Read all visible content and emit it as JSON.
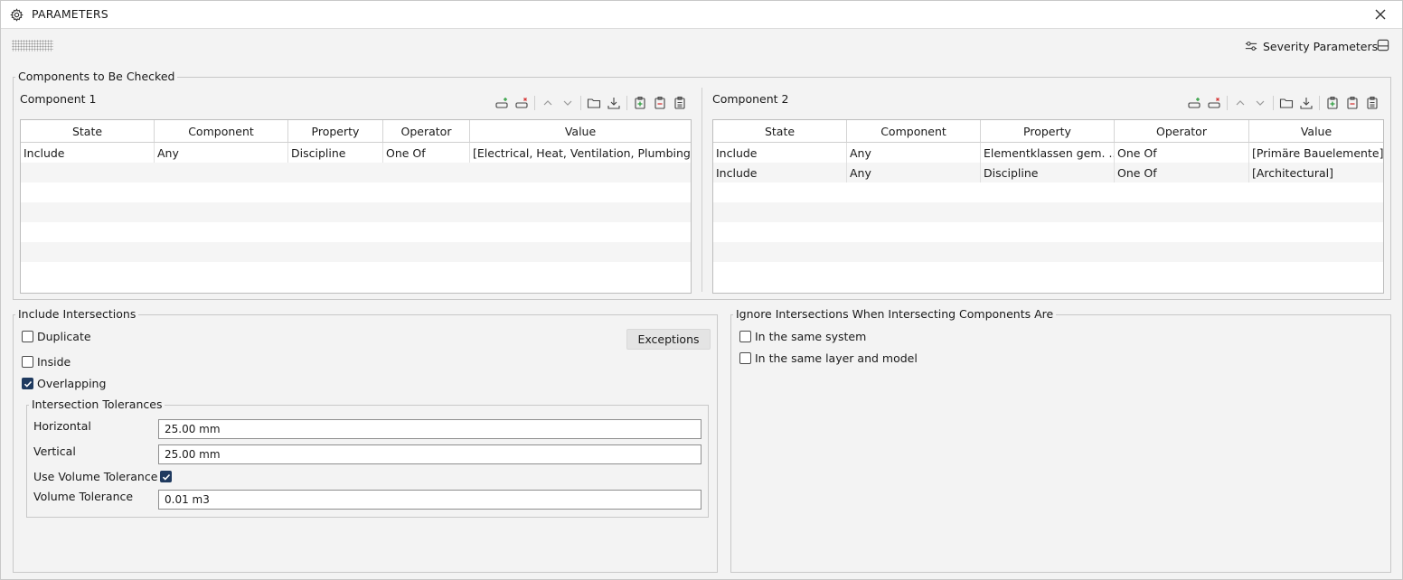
{
  "window": {
    "title": "PARAMETERS"
  },
  "header": {
    "severity_label": "Severity Parameters"
  },
  "components": {
    "legend": "Components to Be Checked",
    "columns": [
      "State",
      "Component",
      "Property",
      "Operator",
      "Value"
    ],
    "component1": {
      "title": "Component 1",
      "rows": [
        [
          "Include",
          "Any",
          "Discipline",
          "One Of",
          "[Electrical, Heat, Ventilation, Plumbing]"
        ]
      ]
    },
    "component2": {
      "title": "Component 2",
      "rows": [
        [
          "Include",
          "Any",
          "Elementklassen gem. ...",
          "One Of",
          "[Primäre Bauelemente]"
        ],
        [
          "Include",
          "Any",
          "Discipline",
          "One Of",
          "[Architectural]"
        ]
      ]
    }
  },
  "include": {
    "legend": "Include Intersections",
    "exceptions_label": "Exceptions",
    "duplicate": {
      "label": "Duplicate",
      "checked": false
    },
    "inside": {
      "label": "Inside",
      "checked": false
    },
    "overlapping": {
      "label": "Overlapping",
      "checked": true
    },
    "tolerances": {
      "legend": "Intersection Tolerances",
      "horizontal_label": "Horizontal",
      "horizontal_value": "25.00 mm",
      "vertical_label": "Vertical",
      "vertical_value": "25.00 mm",
      "use_volume_label": "Use Volume Tolerance",
      "use_volume_checked": true,
      "volume_label": "Volume Tolerance",
      "volume_value": "0.01 m3"
    }
  },
  "ignore": {
    "legend": "Ignore Intersections When Intersecting Components Are",
    "same_system": {
      "label": "In the same system",
      "checked": false
    },
    "same_layer": {
      "label": "In the same layer and model",
      "checked": false
    }
  },
  "colors": {
    "add_green": "#2e9e3f",
    "remove_red": "#d63b3b",
    "check_navy": "#1f3a5f"
  }
}
